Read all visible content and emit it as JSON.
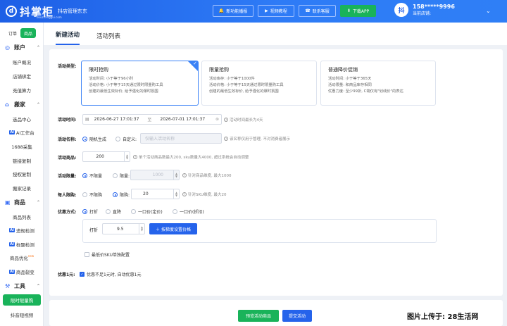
{
  "header": {
    "logo_text": "抖掌柜",
    "logo_tagline": "抖店管理东东",
    "logo_sub": "douzhanggui.com",
    "buttons": [
      "新功能播报",
      "视频教程",
      "联系客服",
      "下载APP"
    ],
    "user_phone": "158*****9996",
    "user_shop_label": "当前店铺:",
    "avatar_text": "抖"
  },
  "sidebar": {
    "switch": [
      "订单",
      "商品"
    ],
    "groups": [
      {
        "label": "账户",
        "items": [
          "账户概况",
          "店铺绑定",
          "充值算力"
        ]
      },
      {
        "label": "搬家",
        "items": [
          "选品中心",
          "AI工作台",
          "1688采集",
          "链接复制",
          "授权复制",
          "搬家记录"
        ]
      },
      {
        "label": "商品",
        "items": [
          "商品列表",
          "违规检测",
          "标题检测",
          "商品优化",
          "商品裂变"
        ]
      },
      {
        "label": "工具",
        "items": [
          "限时限量购",
          "抖音短视频"
        ]
      }
    ],
    "new_badge": "new"
  },
  "tabs": [
    "新建活动",
    "活动列表"
  ],
  "form": {
    "type_label": "活动类型:",
    "types": [
      {
        "title": "限时抢购",
        "lines": [
          "活动时间: 小于等于96小时",
          "活动价格: 小于等于15天通过限时限量购工具",
          "创建的最低生效标价, 给予强化的爆时氛围"
        ]
      },
      {
        "title": "限量抢购",
        "lines": [
          "活动库存: 小于等于1000件",
          "活动价格: 小于等于15天通过限时限量购工具",
          "创建的最低生效标价, 给予强化的爆时氛围"
        ]
      },
      {
        "title": "普通降价促销",
        "lines": [
          "活动时间: 小于等于365天",
          "活动限量: 和商品库存相同",
          "优惠力度: 至少99折, C端仅有\"划线价\"的表达"
        ]
      }
    ],
    "time_label": "活动时间:",
    "time_start": "2026-06-27 17:01:37",
    "time_sep": "至",
    "time_end": "2026-07-01 17:01:37",
    "time_hint": "活动时间最长为4天",
    "name_label": "活动名称:",
    "name_opt1": "随机生成",
    "name_opt2": "自定义:",
    "name_placeholder": "仅输入活动名称",
    "name_hint": "该名称仅用于管理, 不对消费者展示",
    "goods_label": "活动商品:",
    "goods_value": "200",
    "goods_hint": "单个活动商品数最大200, sku数量大4000, 超过系统会自动调整",
    "limit_label": "活动限量:",
    "limit_opt1": "不限量",
    "limit_opt2": "限量:",
    "limit_value": "1000",
    "limit_hint": "针对商品维度, 最大1000",
    "per_label": "每人限购:",
    "per_opt1": "不限购",
    "per_opt2": "限购:",
    "per_value": "20",
    "per_hint": "针对SKU维度, 最大20",
    "discount_label": "优惠方式:",
    "discount_opts": [
      "打折",
      "直降",
      "一口价(定价)",
      "一口价(折扣)"
    ],
    "discount_sub_label": "打折",
    "discount_value": "9.5",
    "gradient_btn": "按梯度设置价格",
    "min_sku_label": "最低价SKU单独配置",
    "one_yuan_label": "优惠1元:",
    "one_yuan_text": "优惠不足1元时, 自动优惠1元"
  },
  "footer": {
    "preview_btn": "预览活动商品",
    "submit_btn": "提交活动"
  },
  "watermark": "图片上传于: 28生活网"
}
